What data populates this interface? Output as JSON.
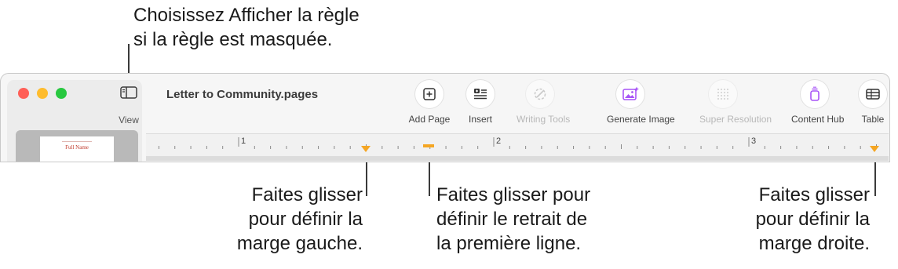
{
  "callouts": {
    "top": "Choisissez Afficher la règle\nsi la règle est masquée.",
    "left_margin": "Faites glisser\npour définir la\nmarge gauche.",
    "first_line": "Faites glisser pour\ndéfinir le retrait de\nla première ligne.",
    "right_margin": "Faites glisser\npour définir la\nmarge droite."
  },
  "window": {
    "title": "Letter to Community.pages",
    "view_label": "View",
    "thumbnail_heading": "Full Name"
  },
  "toolbar": {
    "items": [
      {
        "label": "Add Page",
        "icon": "plus-square-icon",
        "enabled": true
      },
      {
        "label": "Insert",
        "icon": "insert-list-icon",
        "enabled": true
      },
      {
        "label": "Writing Tools",
        "icon": "writing-tools-icon",
        "enabled": false
      },
      {
        "label": "Generate Image",
        "icon": "generate-image-icon",
        "enabled": true
      },
      {
        "label": "Super Resolution",
        "icon": "super-resolution-icon",
        "enabled": false
      },
      {
        "label": "Content Hub",
        "icon": "content-hub-icon",
        "enabled": true
      },
      {
        "label": "Table",
        "icon": "table-icon",
        "enabled": true
      }
    ]
  },
  "ruler": {
    "numbers": [
      "1",
      "2",
      "3"
    ],
    "units": "inches",
    "left_margin_marker_in": 0.5,
    "first_line_indent_marker_in": 0.75,
    "right_margin_marker_in": 3.5
  },
  "colors": {
    "marker": "#f5a623",
    "accent_purple": "#a855f7",
    "close": "#ff5f57",
    "minimize": "#febc2e",
    "maximize": "#28c840"
  }
}
